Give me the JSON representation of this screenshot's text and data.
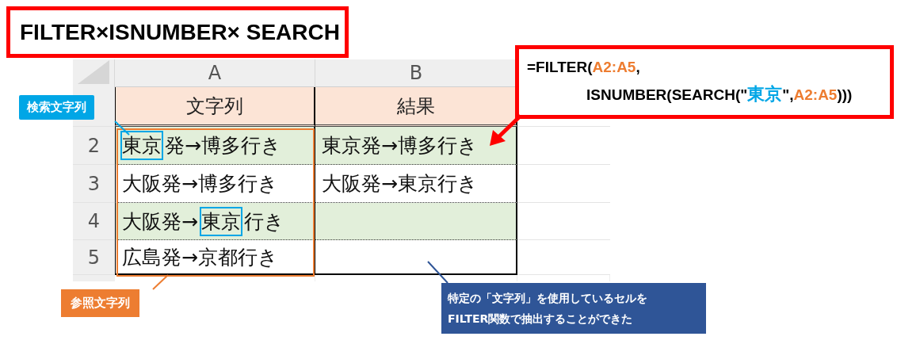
{
  "title": "FILTER×ISNUMBER× SEARCH",
  "formula": {
    "lines": [
      {
        "parts": [
          {
            "text": "=FILTER(",
            "kind": "plain"
          },
          {
            "text": "A2:A5",
            "kind": "range"
          },
          {
            "text": ",",
            "kind": "plain"
          }
        ]
      },
      {
        "parts": [
          {
            "text": "ISNUMBER(SEARCH(\"",
            "kind": "plain"
          },
          {
            "text": "東京",
            "kind": "criteria"
          },
          {
            "text": "\",",
            "kind": "plain"
          },
          {
            "text": "A2:A5",
            "kind": "range"
          },
          {
            "text": ")))",
            "kind": "plain"
          }
        ]
      }
    ]
  },
  "sheet": {
    "columns": [
      "A",
      "B"
    ],
    "header": [
      "文字列",
      "結果"
    ],
    "rows": [
      {
        "number": "2",
        "shaded": true,
        "cells": [
          {
            "parts": [
              {
                "text": "東京",
                "match": true
              },
              {
                "text": "発→博多行き",
                "match": false
              }
            ]
          },
          {
            "parts": [
              {
                "text": "東京発→博多行き",
                "match": false
              }
            ]
          }
        ]
      },
      {
        "number": "3",
        "shaded": false,
        "cells": [
          {
            "parts": [
              {
                "text": "大阪発→博多行き",
                "match": false
              }
            ]
          },
          {
            "parts": [
              {
                "text": "大阪発→東京行き",
                "match": false
              }
            ]
          }
        ]
      },
      {
        "number": "4",
        "shaded": true,
        "cells": [
          {
            "parts": [
              {
                "text": "大阪発→",
                "match": false
              },
              {
                "text": "東京",
                "match": true
              },
              {
                "text": "行き",
                "match": false
              }
            ]
          }
        ]
      },
      {
        "number": "5",
        "shaded": false,
        "cells": [
          {
            "parts": [
              {
                "text": "広島発→京都行き",
                "match": false
              }
            ]
          }
        ]
      }
    ]
  },
  "callouts": [
    {
      "kind": "search",
      "text": "検索文字列"
    },
    {
      "kind": "reference",
      "text": "参照文字列"
    },
    {
      "kind": "note",
      "text": "特定の「文字列」を使用しているセルを\nFILTER関数で抽出することができた"
    }
  ]
}
